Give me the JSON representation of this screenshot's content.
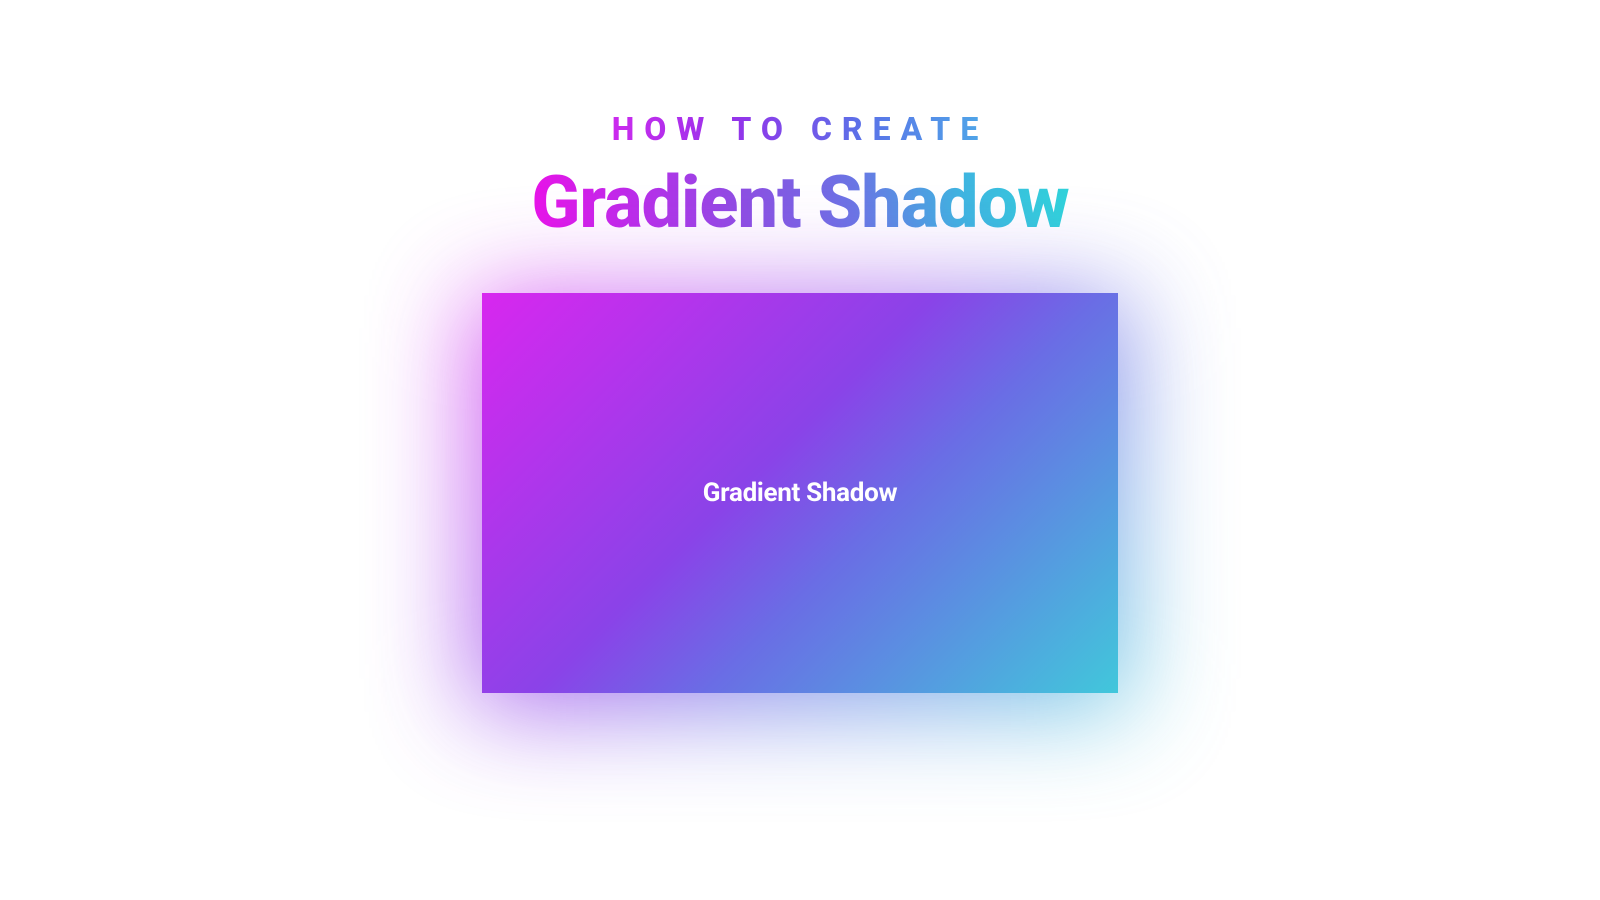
{
  "header": {
    "subtitle": "HOW TO CREATE",
    "title": "Gradient Shadow"
  },
  "card": {
    "label": "Gradient Shadow"
  },
  "colors": {
    "gradient_start": "#d827ef",
    "gradient_mid1": "#8a43e8",
    "gradient_mid2": "#6a6de5",
    "gradient_end": "#41c7db"
  }
}
